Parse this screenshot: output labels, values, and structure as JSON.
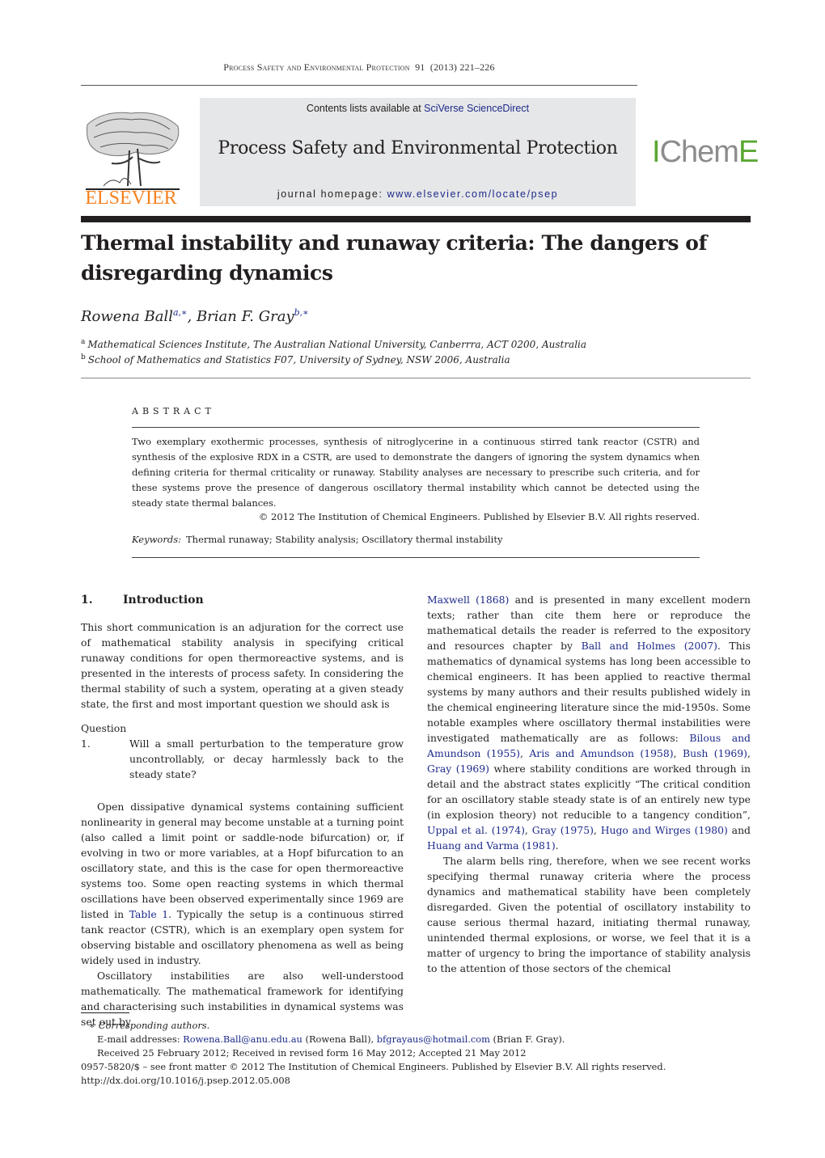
{
  "running_header": {
    "journal": "Process Safety and Environmental Protection",
    "volume": "91",
    "year": "(2013)",
    "pages": "221–226"
  },
  "masthead": {
    "publisher_logo": "ELSEVIER",
    "contents_prefix": "Contents lists available at ",
    "contents_link": "SciVerse ScienceDirect",
    "journal_name": "Process Safety and Environmental Protection",
    "homepage_prefix": "journal homepage: ",
    "homepage_link": "www.elsevier.com/locate/psep",
    "society_logo_prefix": "I",
    "society_logo_middle": "Chem",
    "society_logo_suffix": "E",
    "colors": {
      "elsevier_orange": "#f58220",
      "icheme_green": "#5aa832",
      "link_blue": "#1d2a8a",
      "masthead_gray": "#e6e7e8"
    }
  },
  "article": {
    "title": "Thermal instability and runaway criteria: The dangers of disregarding dynamics",
    "authors": [
      {
        "name": "Rowena Ball",
        "marks": "a,∗"
      },
      {
        "name": "Brian F. Gray",
        "marks": "b,∗"
      }
    ],
    "author_separator": ", ",
    "affiliations": [
      {
        "mark": "a",
        "text": "Mathematical Sciences Institute, The Australian National University, Canberrra, ACT 0200, Australia"
      },
      {
        "mark": "b",
        "text": "School of Mathematics and Statistics F07, University of Sydney, NSW 2006, Australia"
      }
    ]
  },
  "abstract": {
    "heading": "ABSTRACT",
    "body": "Two exemplary exothermic processes, synthesis of nitroglycerine in a continuous stirred tank reactor (CSTR) and synthesis of the explosive RDX in a CSTR, are used to demonstrate the dangers of ignoring the system dynamics when defining criteria for thermal criticality or runaway. Stability analyses are necessary to prescribe such criteria, and for these systems prove the presence of dangerous oscillatory thermal instability which cannot be detected using the steady state thermal balances.",
    "copyright": "© 2012 The Institution of Chemical Engineers. Published by Elsevier B.V. All rights reserved.",
    "keywords_label": "Keywords:",
    "keywords": "Thermal runaway; Stability analysis; Oscillatory thermal instability"
  },
  "body": {
    "section": {
      "number": "1.",
      "title": "Introduction"
    },
    "p1": "This short communication is an adjuration for the correct use of mathematical stability analysis in specifying critical runaway conditions for open thermoreactive systems, and is presented in the interests of process safety. In considering the thermal stability of such a system, operating at a given steady state, the first and most important question we should ask is",
    "question_label": "Question 1.",
    "question_text": "Will a small perturbation to the temperature grow uncontrollably, or decay harmlessly back to the steady state?",
    "p2_a": "Open dissipative dynamical systems containing sufficient nonlinearity in general may become unstable at a turning point (also called a limit point or saddle-node bifurcation) or, if evolving in two or more variables, at a Hopf bifurcation to an oscillatory state, and this is the case for open thermoreactive systems too. Some open reacting systems in which thermal oscillations have been observed experimentally since 1969 are listed in ",
    "p2_link": "Table 1",
    "p2_b": ". Typically the setup is a continuous stirred tank reactor (CSTR), which is an exemplary open system for observing bistable and oscillatory phenomena as well as being widely used in industry.",
    "p3_a": "Oscillatory instabilities are also well-understood mathematically. The mathematical framework for identifying and characterising such instabilities in dynamical systems was set out by ",
    "p3_ref1": "Maxwell (1868)",
    "p3_b": " and is presented in many excellent modern texts; rather than cite them here or reproduce the mathematical details the reader is referred to the expository and resources chapter by ",
    "p3_ref2": "Ball and Holmes (2007)",
    "p3_c": ". This mathematics of dynamical systems has long been accessible to chemical engineers. It has been applied to reactive thermal systems by many authors and their results published widely in the chemical engineering literature since the mid-1950s. Some notable examples where oscillatory thermal instabilities were investigated mathematically are as follows: ",
    "p3_ref3": "Bilous and Amundson (1955)",
    "p3_ref4": "Aris and Amundson (1958)",
    "p3_ref5": "Bush (1969)",
    "p3_ref6": "Gray (1969)",
    "p3_d": " where stability conditions are worked through in detail and the abstract states explicitly “The critical condition for an oscillatory stable steady state is of an entirely new type (in explosion theory) not reducible to a tangency condition”, ",
    "p3_ref7": "Uppal et al. (1974)",
    "p3_ref8": "Gray (1975)",
    "p3_ref9": "Hugo and Wirges (1980)",
    "p3_and": " and ",
    "p3_ref10": "Huang and Varma (1981)",
    "p3_end": ".",
    "sep": ", ",
    "p4": "The alarm bells ring, therefore, when we see recent works specifying thermal runaway criteria where the process dynamics and mathematical stability have been completely disregarded. Given the potential of oscillatory instability to cause serious thermal hazard, initiating thermal runaway, unintended thermal explosions, or worse, we feel that it is a matter of urgency to bring the importance of stability analysis to the attention of those sectors of the chemical"
  },
  "footnotes": {
    "star_mark": "∗",
    "corresponding": "Corresponding authors.",
    "email_label": "E-mail addresses: ",
    "email1": "Rowena.Ball@anu.edu.au",
    "email1_name": " (Rowena Ball), ",
    "email2": "bfgrayaus@hotmail.com",
    "email2_name": " (Brian F. Gray).",
    "received": "Received 25 February 2012; Received in revised form 16 May 2012; Accepted 21 May 2012",
    "issn": "0957-5820/$ – see front matter © 2012 The Institution of Chemical Engineers. Published by Elsevier B.V. All rights reserved.",
    "doi": "http://dx.doi.org/10.1016/j.psep.2012.05.008"
  }
}
